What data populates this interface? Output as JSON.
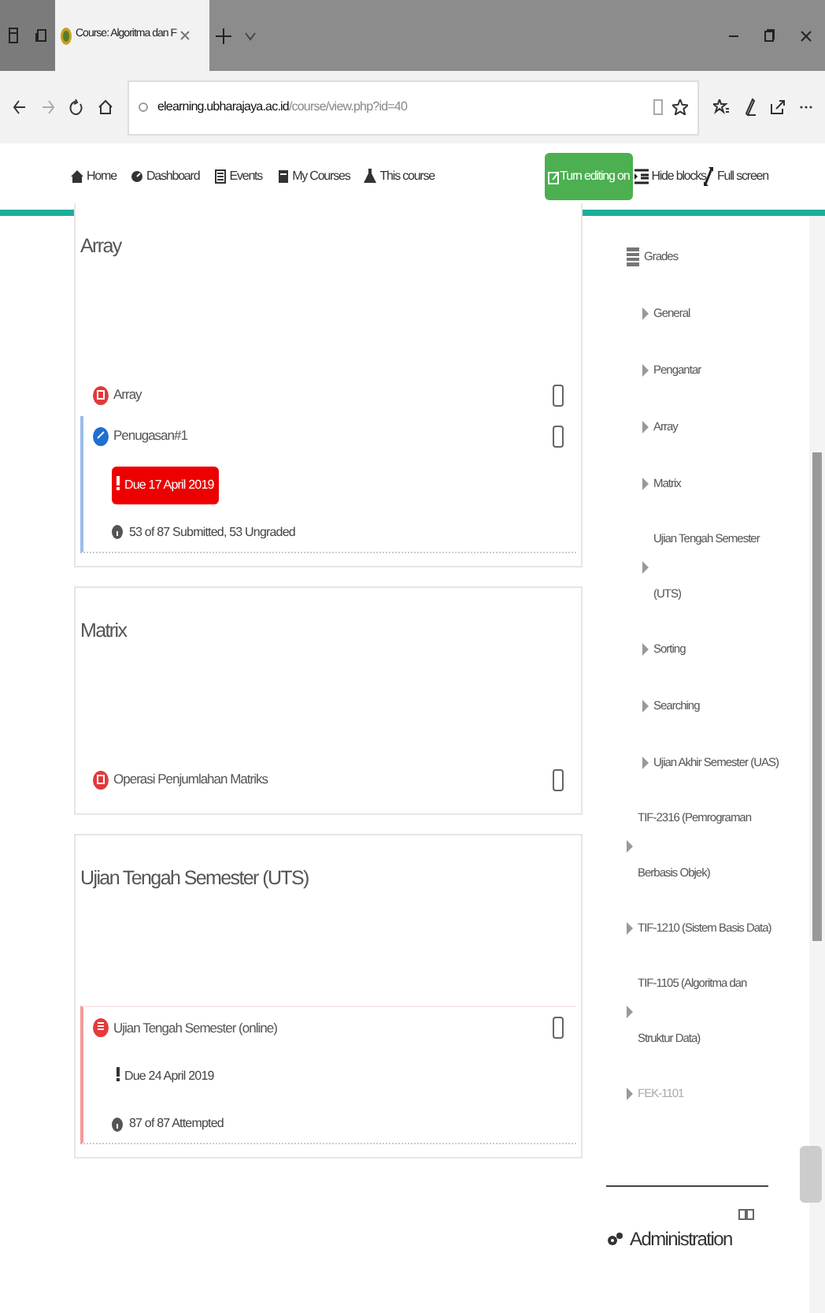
{
  "browser": {
    "tab_title": "Course: Algoritma dan F",
    "url_host": "elearning.ubharajaya.ac.id",
    "url_path": "/course/view.php?id=40"
  },
  "navbar": {
    "links": [
      {
        "label": "Home",
        "kind": "home"
      },
      {
        "label": "Dashboard",
        "kind": "dashboard"
      },
      {
        "label": "Events",
        "kind": "events"
      },
      {
        "label": "My Courses",
        "kind": "courses"
      },
      {
        "label": "This course",
        "kind": "course"
      }
    ],
    "editing_button": "Turn editing on",
    "hide_blocks": "Hide blocks",
    "full_screen": "Full screen"
  },
  "sections": [
    {
      "title": "Array",
      "activities": [
        {
          "kind": "resource",
          "name": "Array",
          "completed": false
        },
        {
          "kind": "assign",
          "name": "Penugasan#1",
          "completed": false,
          "due": "Due 17 April 2019",
          "overdue": true,
          "info": "53 of 87 Submitted, 53 Ungraded"
        }
      ]
    },
    {
      "title": "Matrix",
      "activities": [
        {
          "kind": "resource",
          "name": "Operasi Penjumlahan Matriks",
          "completed": false
        }
      ]
    },
    {
      "title": "Ujian Tengah Semester (UTS)",
      "activities": [
        {
          "kind": "quiz",
          "name": "Ujian Tengah Semester (online)",
          "completed": false,
          "due": "Due 24 April 2019",
          "overdue": false,
          "info": "87 of 87 Attempted"
        }
      ]
    }
  ],
  "sidebar": {
    "grades": "Grades",
    "course_sections": [
      "General",
      "Pengantar",
      "Array",
      "Matrix",
      "Ujian Tengah Semester (UTS)",
      "Sorting",
      "Searching",
      "Ujian Akhir Semester (UAS)"
    ],
    "courses": [
      {
        "label": "TIF-2316 (Pemrograman Berbasis Objek)",
        "dimmed": false
      },
      {
        "label": "TIF-1210 (Sistem Basis Data)",
        "dimmed": false
      },
      {
        "label": "TIF-1105 (Algoritma dan Struktur Data)",
        "dimmed": false
      },
      {
        "label": "FEK-1101",
        "dimmed": true
      }
    ],
    "admin_title": "Administration"
  }
}
